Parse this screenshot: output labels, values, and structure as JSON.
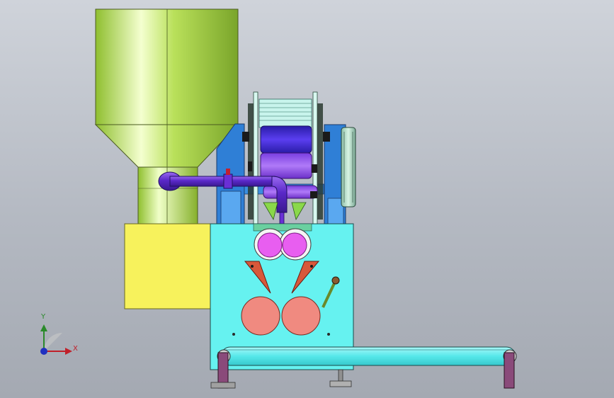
{
  "scene": {
    "background_top": "#cfd3da",
    "background_bottom": "#a4a9b2",
    "colors": {
      "hopper": "#b9e05a",
      "yellow_box": "#f7f25c",
      "cyan_body": "#66f2f0",
      "blue_frame": "#2f7fd6",
      "purple_pipe": "#6a2fd6",
      "roller_magenta": "#e85ef0",
      "roller_salmon": "#f08a80",
      "blade_red": "#d8583a",
      "leg_purple": "#8a4a7a"
    }
  },
  "triad": {
    "x_label": "X",
    "y_label": "Y",
    "x_color": "#c0202a",
    "y_color": "#2a8a2a",
    "z_color": "#2030c0"
  }
}
